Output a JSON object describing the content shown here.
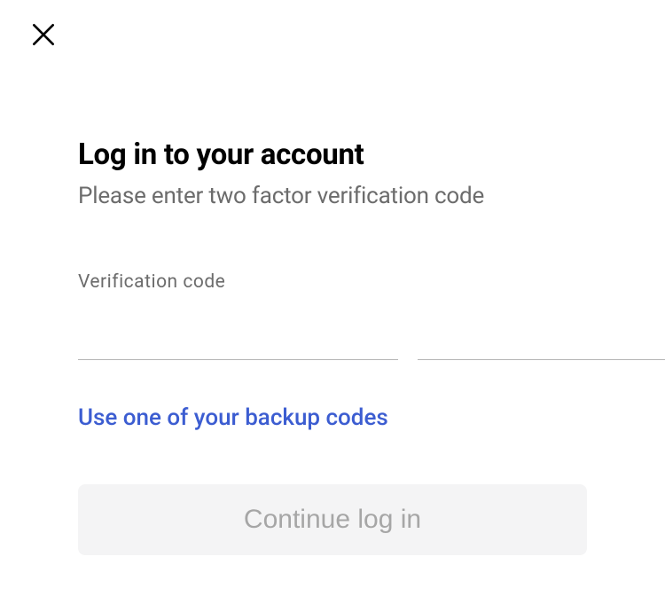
{
  "header": {
    "title": "Log in to your account",
    "subtitle": "Please enter two factor verification code"
  },
  "form": {
    "field_label": "Verification code",
    "backup_link": "Use one of your backup codes",
    "continue_button": "Continue log in"
  }
}
